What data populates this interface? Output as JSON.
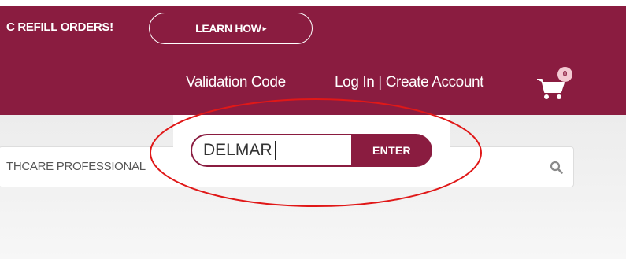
{
  "promo": {
    "text": "C REFILL ORDERS!",
    "button_label": "LEARN HOW",
    "button_arrow": "▸"
  },
  "nav": {
    "validation_code": "Validation Code",
    "login": "Log In | Create Account"
  },
  "cart": {
    "icon": "shopping-cart-icon",
    "count": "0"
  },
  "search": {
    "text": "THCARE PROFESSIONAL",
    "icon": "search-icon"
  },
  "validation_popup": {
    "input_value": "DELMAR",
    "enter_label": "ENTER"
  },
  "colors": {
    "brand": "#8a1c40",
    "annotation": "#e01818"
  }
}
